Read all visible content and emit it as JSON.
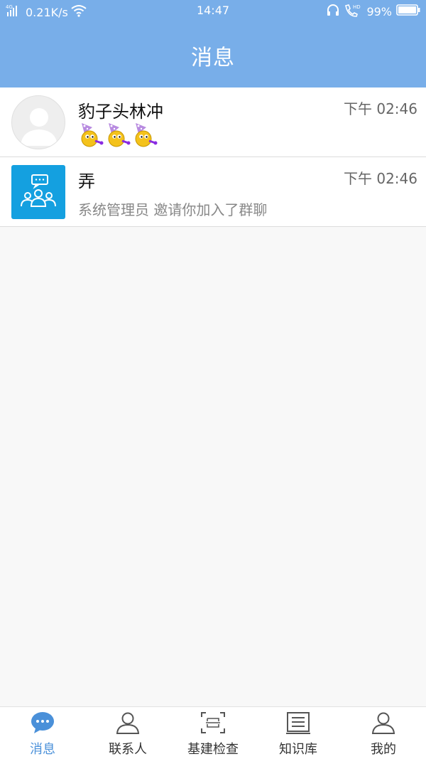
{
  "status_bar": {
    "signal_label": "4G",
    "net_speed": "0.21K/s",
    "time": "14:47",
    "hd_label": "HD",
    "battery": "99%"
  },
  "header": {
    "title": "消息"
  },
  "chats": [
    {
      "name": "豹子头林冲",
      "time": "下午 02:46",
      "preview": "",
      "avatar": "default-user-avatar",
      "preview_icons": [
        "party-emoji-icon",
        "party-emoji-icon",
        "party-emoji-icon"
      ]
    },
    {
      "name": "弄",
      "time": "下午 02:46",
      "preview": "系统管理员 邀请你加入了群聊",
      "avatar": "group-chat-icon"
    }
  ],
  "bottom_nav": [
    {
      "label": "消息",
      "icon": "chat-bubble-icon",
      "active": true
    },
    {
      "label": "联系人",
      "icon": "person-icon",
      "active": false
    },
    {
      "label": "基建检查",
      "icon": "scan-icon",
      "active": false
    },
    {
      "label": "知识库",
      "icon": "document-icon",
      "active": false
    },
    {
      "label": "我的",
      "icon": "profile-icon",
      "active": false
    }
  ],
  "colors": {
    "accent": "#78aee9",
    "active_tab": "#4a90d9",
    "group_avatar_bg": "#14a0e0"
  }
}
